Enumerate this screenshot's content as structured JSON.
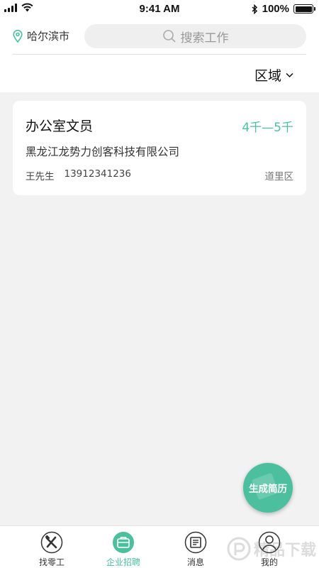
{
  "status_bar": {
    "time": "9:41 AM",
    "battery": "100%"
  },
  "header": {
    "city": "哈尔滨市",
    "search_placeholder": "搜索工作",
    "filter_label": "区域"
  },
  "job": {
    "title": "办公室文员",
    "salary": "4千—5千",
    "company": "黑龙江龙势力创客科技有限公司",
    "contact_name": "王先生",
    "phone": "13912341236",
    "district": "道里区"
  },
  "fab": {
    "label": "生成简历"
  },
  "tabs": [
    {
      "label": "找零工",
      "icon": "tools-icon"
    },
    {
      "label": "企业招聘",
      "icon": "briefcase-icon",
      "active": true
    },
    {
      "label": "消息",
      "icon": "message-icon"
    },
    {
      "label": "我的",
      "icon": "user-icon"
    }
  ],
  "watermark": {
    "text": "精品下载"
  },
  "colors": {
    "accent": "#4cbf9f",
    "background": "#f2f2f2"
  }
}
